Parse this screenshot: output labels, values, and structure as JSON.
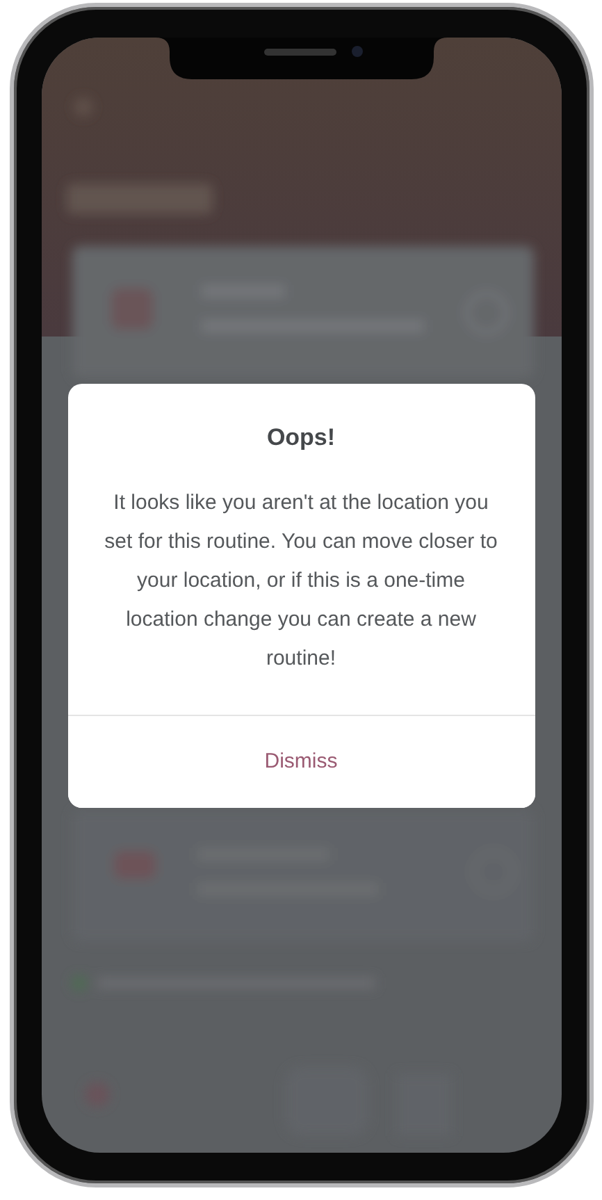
{
  "dialog": {
    "title": "Oops!",
    "message": "It looks like you aren't at the location you set for this routine. You can move closer to your location, or if this is a one-time location change you can create a new routine!",
    "button": "Dismiss"
  }
}
